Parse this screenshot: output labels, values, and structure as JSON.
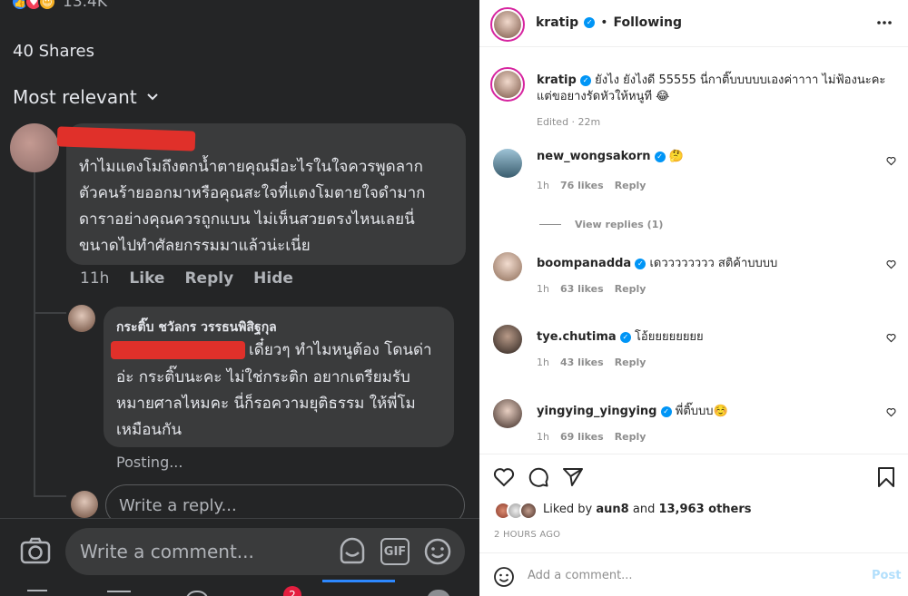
{
  "fb": {
    "reaction_count": "13.4K",
    "shares": "40 Shares",
    "sort_label": "Most relevant",
    "comment1": {
      "lines": [
        "ทำไมแตงโมถึงตกน้ำตายคุณมีอะไรในใจควรพูดลาก",
        "ตัวคนร้ายออกมาหรือคุณสะใจที่แตงโมตายใจดำมาก",
        "ดาราอย่างคุณควรถูกแบน ไม่เห็นสวยตรงไหนเลยนี่",
        "ขนาดไปทำศัลยกรรมมาแล้วน่ะเนี่ย"
      ],
      "time": "11h",
      "like": "Like",
      "reply": "Reply",
      "hide": "Hide"
    },
    "reply1": {
      "author": "กระติ๊บ ชวัลกร วรรธนพิสิฐกุล",
      "lines": [
        "เดี๋ยวๆ ทำไมหนูต้อง โดนด่า",
        "อ่ะ กระติ๊บนะคะ ไม่ใช่กระติก อยากเตรียมรับ",
        "หมายศาลไหมคะ นี่ก็รอความยุติธรรม ให้พี่โม",
        "เหมือนกัน"
      ],
      "status": "Posting..."
    },
    "reply_placeholder": "Write a reply...",
    "comment_placeholder": "Write a comment...",
    "gif_label": "GIF",
    "notif_badge": "2",
    "colors": {
      "bg": "#242526",
      "bubble": "#3a3b3c",
      "redact": "#e0302a",
      "accent": "#2d88ff"
    }
  },
  "ig": {
    "header": {
      "username": "kratip",
      "follow_state": "Following",
      "separator": "•"
    },
    "caption": {
      "username": "kratip",
      "text": "ยังไง ยังไงดี 55555 นี่กาติ๊บบบบบเองค่าาาา ไม่ฟ้องนะคะ แต่ขอยางรัดหัวให้หนูที",
      "emoji": "😂",
      "meta": "Edited · 22m"
    },
    "comments": [
      {
        "username": "new_wongsakorn",
        "text": "🤔",
        "time": "1h",
        "likes": "76 likes",
        "reply": "Reply"
      },
      {
        "username": "boompanadda",
        "text": "เดวววววววว สติค้าบบบบ",
        "time": "1h",
        "likes": "63 likes",
        "reply": "Reply"
      },
      {
        "username": "tye.chutima",
        "text": "โอ้ยยยยยยยย",
        "time": "1h",
        "likes": "43 likes",
        "reply": "Reply"
      },
      {
        "username": "yingying_yingying",
        "text": "พี่ติ๊บบบ☺️",
        "time": "1h",
        "likes": "69 likes",
        "reply": "Reply"
      }
    ],
    "view_replies": "View replies (1)",
    "liked_prefix": "Liked by",
    "liked_user": "aun8",
    "liked_and": "and",
    "liked_others": "13,963 others",
    "post_time": "2 HOURS AGO",
    "add_comment": "Add a comment...",
    "post_button": "Post",
    "colors": {
      "verified": "#0095f6",
      "post": "#b2dffc"
    }
  }
}
